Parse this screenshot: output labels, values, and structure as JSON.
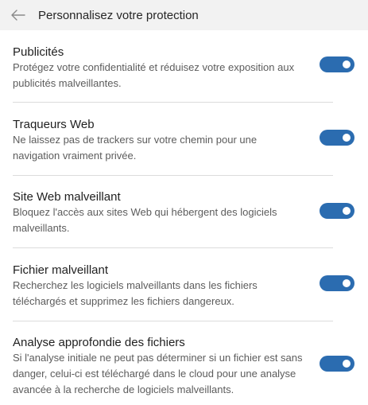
{
  "header": {
    "back_icon": "arrow-left-icon",
    "title": "Personnalisez votre protection"
  },
  "colors": {
    "toggle_on": "#2b6cb0",
    "header_bg": "#f2f2f2",
    "description": "#5c5c5c"
  },
  "settings": [
    {
      "title": "Publicités",
      "description": "Protégez votre confidentialité et réduisez votre exposition aux publicités malveillantes.",
      "enabled": true
    },
    {
      "title": "Traqueurs Web",
      "description": "Ne laissez pas de trackers sur votre chemin pour une navigation vraiment privée.",
      "enabled": true
    },
    {
      "title": "Site Web malveillant",
      "description": "Bloquez l'accès aux sites Web qui hébergent des logiciels malveillants.",
      "enabled": true
    },
    {
      "title": "Fichier malveillant",
      "description": "Recherchez les logiciels malveillants dans les fichiers téléchargés et supprimez les fichiers dangereux.",
      "enabled": true
    },
    {
      "title": "Analyse approfondie des fichiers",
      "description": "Si l'analyse initiale ne peut pas déterminer si un fichier est sans danger, celui-ci est téléchargé dans le cloud pour une analyse avancée à la recherche de logiciels malveillants.",
      "enabled": true
    }
  ]
}
